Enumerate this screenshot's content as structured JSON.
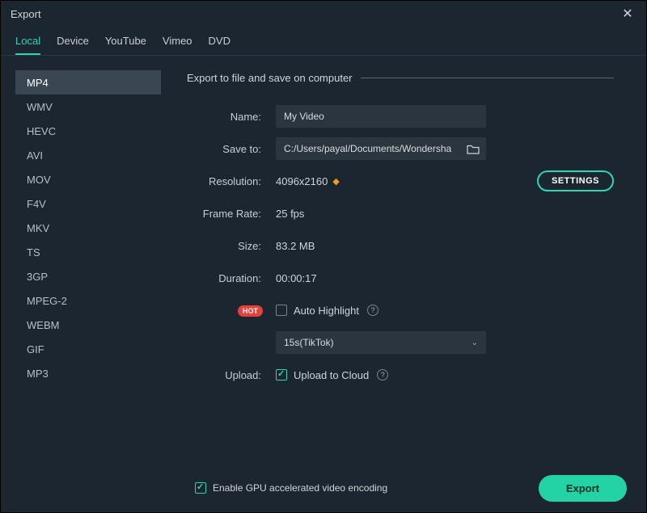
{
  "window": {
    "title": "Export"
  },
  "tabs": [
    {
      "label": "Local",
      "active": true
    },
    {
      "label": "Device",
      "active": false
    },
    {
      "label": "YouTube",
      "active": false
    },
    {
      "label": "Vimeo",
      "active": false
    },
    {
      "label": "DVD",
      "active": false
    }
  ],
  "formats": [
    {
      "label": "MP4",
      "selected": true
    },
    {
      "label": "WMV",
      "selected": false
    },
    {
      "label": "HEVC",
      "selected": false
    },
    {
      "label": "AVI",
      "selected": false
    },
    {
      "label": "MOV",
      "selected": false
    },
    {
      "label": "F4V",
      "selected": false
    },
    {
      "label": "MKV",
      "selected": false
    },
    {
      "label": "TS",
      "selected": false
    },
    {
      "label": "3GP",
      "selected": false
    },
    {
      "label": "MPEG-2",
      "selected": false
    },
    {
      "label": "WEBM",
      "selected": false
    },
    {
      "label": "GIF",
      "selected": false
    },
    {
      "label": "MP3",
      "selected": false
    }
  ],
  "section": {
    "title": "Export to file and save on computer"
  },
  "fields": {
    "name_label": "Name:",
    "name_value": "My Video",
    "save_label": "Save to:",
    "save_value": "C:/Users/payal/Documents/Wondershare/",
    "resolution_label": "Resolution:",
    "resolution_value": "4096x2160",
    "settings_button": "SETTINGS",
    "framerate_label": "Frame Rate:",
    "framerate_value": "25 fps",
    "size_label": "Size:",
    "size_value": "83.2 MB",
    "duration_label": "Duration:",
    "duration_value": "00:00:17",
    "hot_badge": "HOT",
    "auto_highlight_label": "Auto Highlight",
    "auto_highlight_checked": false,
    "select_value": "15s(TikTok)",
    "upload_label": "Upload:",
    "upload_to_cloud_label": "Upload to Cloud",
    "upload_to_cloud_checked": true
  },
  "footer": {
    "gpu_label": "Enable GPU accelerated video encoding",
    "gpu_checked": true,
    "export_button": "Export"
  }
}
